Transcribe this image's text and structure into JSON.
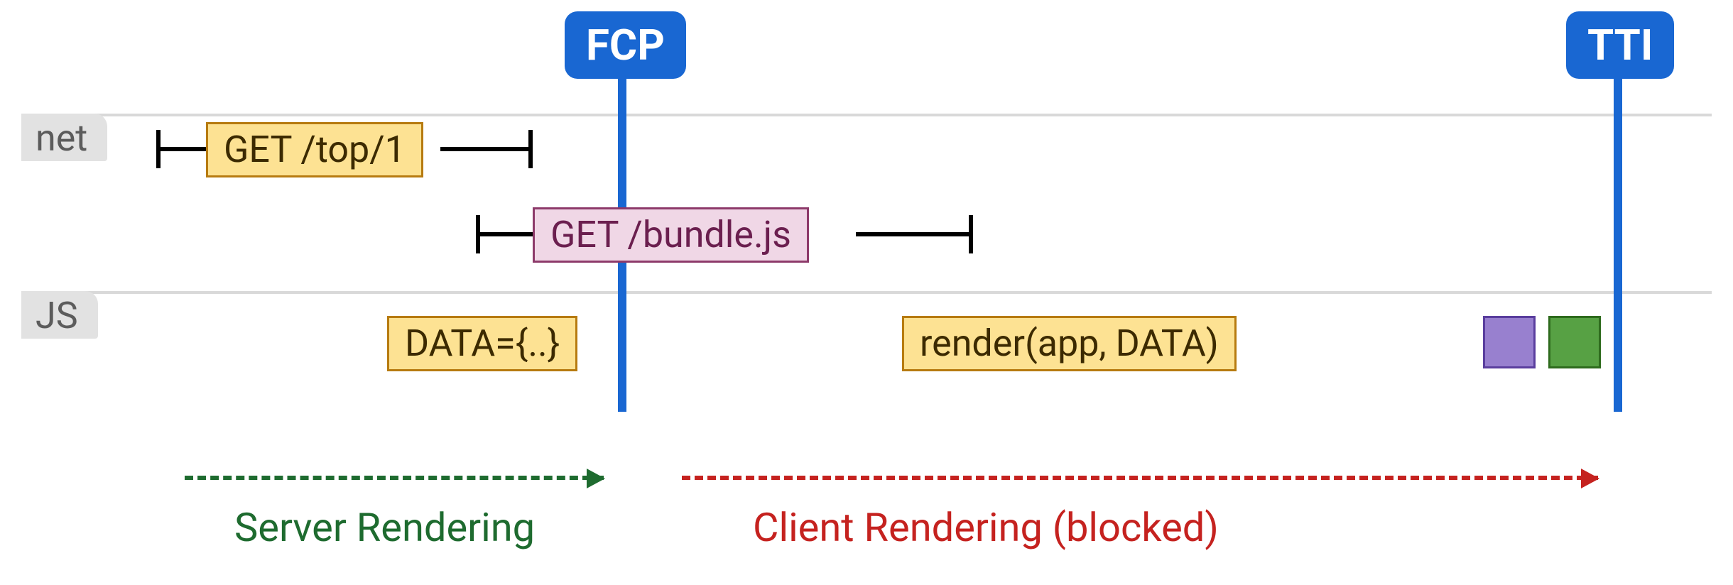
{
  "tracks": {
    "net": {
      "label": "net"
    },
    "js": {
      "label": "JS"
    }
  },
  "markers": {
    "fcp": {
      "label": "FCP"
    },
    "tti": {
      "label": "TTI"
    }
  },
  "spans": {
    "get_top": {
      "label": "GET /top/1"
    },
    "get_bundle": {
      "label": "GET /bundle.js"
    },
    "data_block": {
      "label": "DATA={..}"
    },
    "render": {
      "label": "render(app, DATA)"
    }
  },
  "phases": {
    "server": {
      "label": "Server Rendering"
    },
    "client": {
      "label": "Client Rendering (blocked)"
    }
  },
  "colors": {
    "marker_blue": "#1967d2",
    "box_yellow_bg": "#fde293",
    "box_yellow_border": "#b77b10",
    "box_pink_bg": "#f0d7e6",
    "box_pink_border": "#8d3a6a",
    "square_purple": "#9880cf",
    "square_green": "#57a144",
    "arrow_green": "#1e6b2f",
    "arrow_red": "#c5221f"
  }
}
